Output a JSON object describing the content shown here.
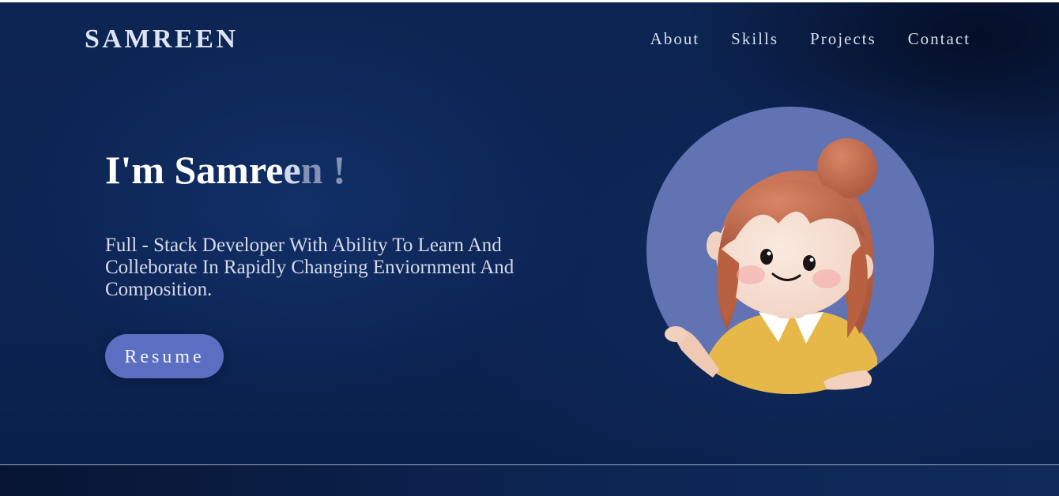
{
  "header": {
    "logo": "SAMREEN",
    "nav": [
      "About",
      "Skills",
      "Projects",
      "Contact"
    ]
  },
  "hero": {
    "title_main": "I'm Samre",
    "title_fade1": "e",
    "title_fade2": "n !",
    "subtitle": "Full - Stack Developer With Ability To Learn And Colleborate In Rapidly Changing Enviornment And Composition.",
    "resume_label": "Resume"
  },
  "colors": {
    "background": "#0d2553",
    "button": "#5b6ec2",
    "avatar_circle": "#6173b3",
    "hair": "#c0684a",
    "shirt": "#e6b84a"
  },
  "icons": {
    "avatar": "cartoon-girl-avatar"
  }
}
